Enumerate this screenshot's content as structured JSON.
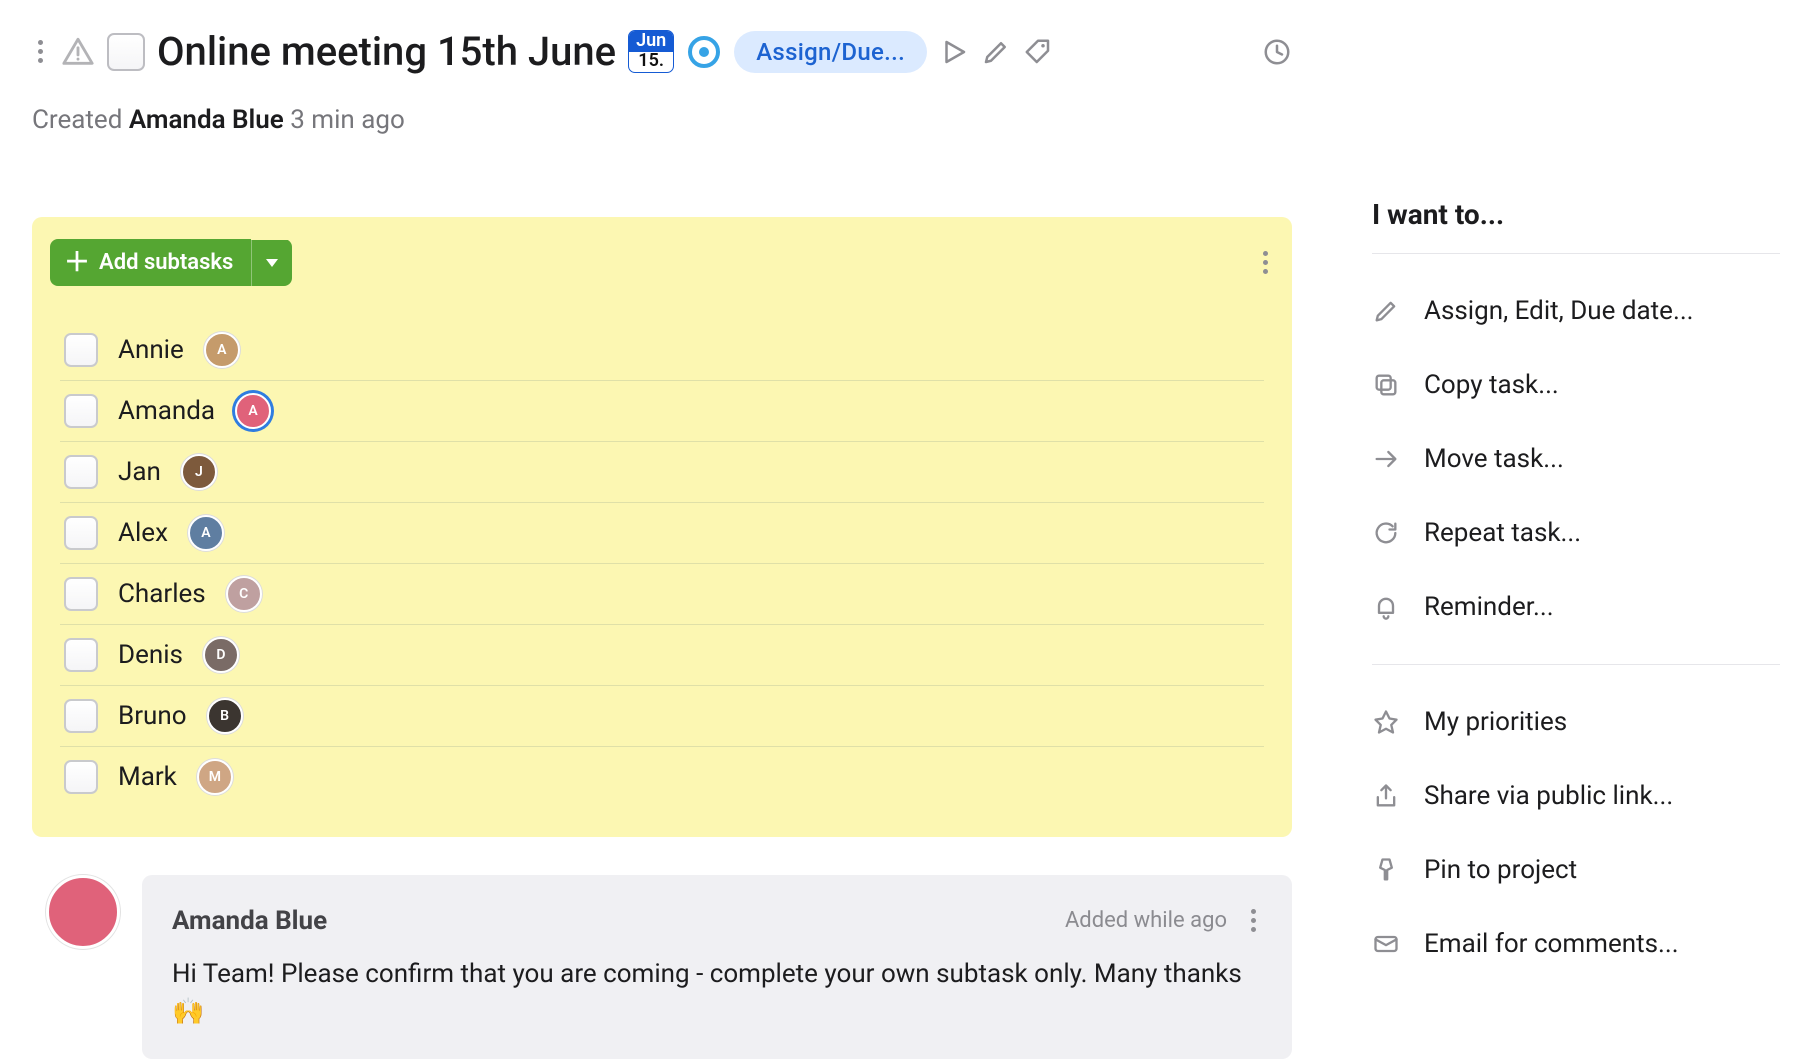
{
  "header": {
    "title": "Online meeting 15th June",
    "date": {
      "month": "Jun",
      "day": "15."
    },
    "assign_pill": "Assign/Due...",
    "created_prefix": "Created",
    "created_by": "Amanda Blue",
    "created_ago": "3 min ago"
  },
  "subtasks": {
    "add_label": "Add subtasks",
    "items": [
      {
        "name": "Annie",
        "avatar_bg": "#c59b6b",
        "highlight": false
      },
      {
        "name": "Amanda",
        "avatar_bg": "#e0627a",
        "highlight": true
      },
      {
        "name": "Jan",
        "avatar_bg": "#7d5a3c",
        "highlight": false
      },
      {
        "name": "Alex",
        "avatar_bg": "#5f7ea1",
        "highlight": false
      },
      {
        "name": "Charles",
        "avatar_bg": "#bfa0a0",
        "highlight": false
      },
      {
        "name": "Denis",
        "avatar_bg": "#7a6b66",
        "highlight": false
      },
      {
        "name": "Bruno",
        "avatar_bg": "#3b3530",
        "highlight": false
      },
      {
        "name": "Mark",
        "avatar_bg": "#cfa684",
        "highlight": false
      }
    ]
  },
  "comment": {
    "author": "Amanda Blue",
    "when": "Added while ago",
    "body": "Hi Team! Please confirm that you are coming - complete your own subtask only. Many thanks 🙌",
    "avatar_bg": "#e0627a"
  },
  "sidebar": {
    "heading": "I want to...",
    "group1": [
      {
        "icon": "pencil",
        "label": "Assign, Edit, Due date..."
      },
      {
        "icon": "copy",
        "label": "Copy task..."
      },
      {
        "icon": "arrow",
        "label": "Move task..."
      },
      {
        "icon": "refresh",
        "label": "Repeat task..."
      },
      {
        "icon": "bell",
        "label": "Reminder..."
      }
    ],
    "group2": [
      {
        "icon": "star",
        "label": "My priorities"
      },
      {
        "icon": "share",
        "label": "Share via public link..."
      },
      {
        "icon": "pin",
        "label": "Pin to project"
      },
      {
        "icon": "envelope",
        "label": "Email for comments..."
      }
    ]
  }
}
